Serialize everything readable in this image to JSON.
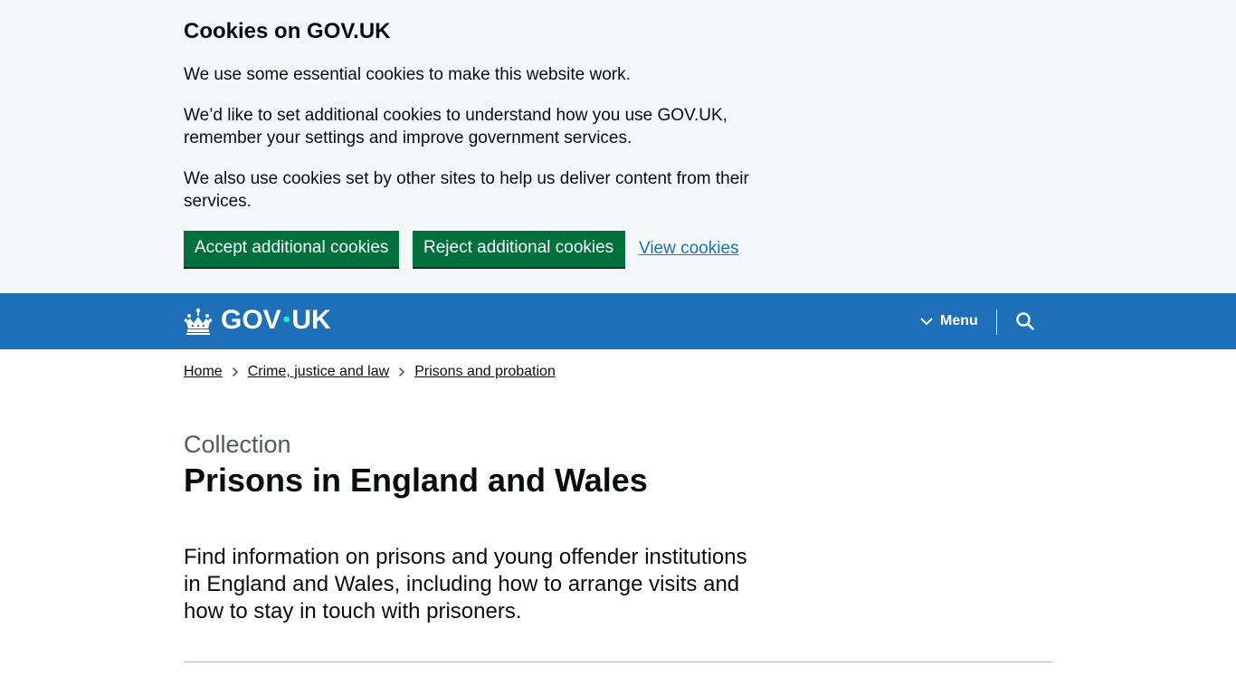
{
  "cookie_banner": {
    "title": "Cookies on GOV.UK",
    "paragraph_1": "We use some essential cookies to make this website work.",
    "paragraph_2": "We’d like to set additional cookies to understand how you use GOV.UK, remember your settings and improve government services.",
    "paragraph_3": "We also use cookies set by other sites to help us deliver content from their services.",
    "accept_label": "Accept additional cookies",
    "reject_label": "Reject additional cookies",
    "view_label": "View cookies"
  },
  "header": {
    "logo_left": "GOV",
    "logo_dot": "•",
    "logo_right": "UK",
    "menu_label": "Menu"
  },
  "breadcrumbs": [
    "Home",
    "Crime, justice and law",
    "Prisons and probation"
  ],
  "main": {
    "caption": "Collection",
    "title": "Prisons in England and Wales",
    "lead": "Find information on prisons and young offender institutions in England and Wales, including how to arrange visits and how to stay in touch with prisoners."
  },
  "colors": {
    "header_blue": "#1d70b8",
    "button_green": "#00703c",
    "link_blue": "#1d70b8",
    "banner_bg": "#f4f8fb"
  }
}
